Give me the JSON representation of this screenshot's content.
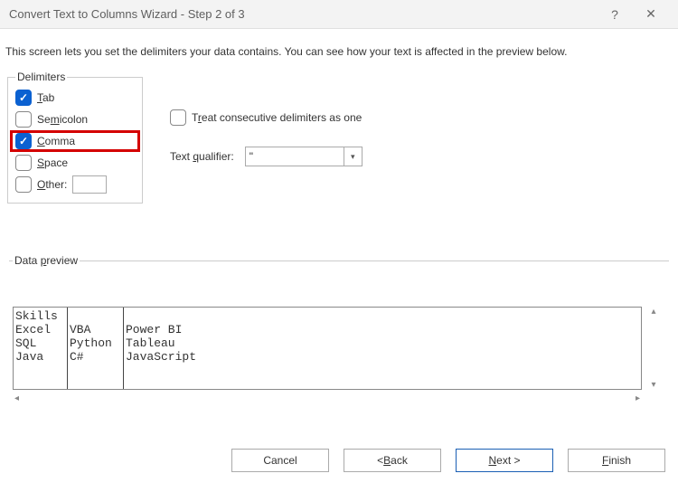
{
  "titlebar": {
    "title": "Convert Text to Columns Wizard - Step 2 of 3"
  },
  "instruction": "This screen lets you set the delimiters your data contains.  You can see how your text is affected in the preview below.",
  "delimiters": {
    "legend": "Delimiters",
    "tab": "Tab",
    "semicolon": "Semicolon",
    "comma": "Comma",
    "space": "Space",
    "other": "Other:"
  },
  "options": {
    "treat_consecutive": "Treat consecutive delimiters as one",
    "qualifier_label": "Text qualifier:",
    "qualifier_value": "\""
  },
  "preview": {
    "legend": "Data preview",
    "col1": "Skills\nExcel\nSQL\nJava",
    "col2": "\nVBA\nPython\nC#",
    "col3": "\nPower BI\nTableau\nJavaScript"
  },
  "buttons": {
    "cancel": "Cancel",
    "back": "< Back",
    "next": "Next >",
    "finish": "Finish"
  }
}
